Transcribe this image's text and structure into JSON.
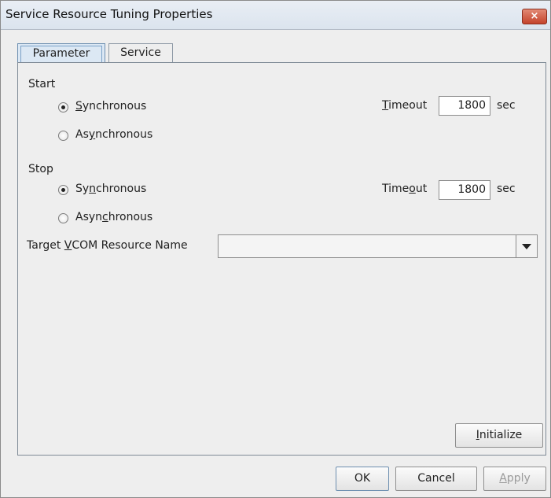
{
  "window": {
    "title": "Service Resource Tuning Properties",
    "close_glyph": "×"
  },
  "tabs": [
    {
      "label": "Parameter"
    },
    {
      "label": "Service"
    }
  ],
  "start": {
    "section_label": "Start",
    "options": [
      {
        "label": "Synchronous",
        "mnemonic": "S",
        "selected": true
      },
      {
        "label": "Asynchronous",
        "mnemonic": "y",
        "selected": false
      }
    ],
    "timeout_label": "Timeout",
    "timeout_value": "1800",
    "unit": "sec"
  },
  "stop": {
    "section_label": "Stop",
    "options": [
      {
        "label": "Synchronous",
        "mnemonic": "n",
        "selected": true
      },
      {
        "label": "Asynchronous",
        "mnemonic": "c",
        "selected": false
      }
    ],
    "timeout_label": "Timeout",
    "timeout_value": "1800",
    "unit": "sec"
  },
  "target": {
    "label": "Target VCOM Resource Name",
    "value": ""
  },
  "buttons": {
    "initialize": "Initialize",
    "ok": "OK",
    "cancel": "Cancel",
    "apply": "Apply"
  }
}
